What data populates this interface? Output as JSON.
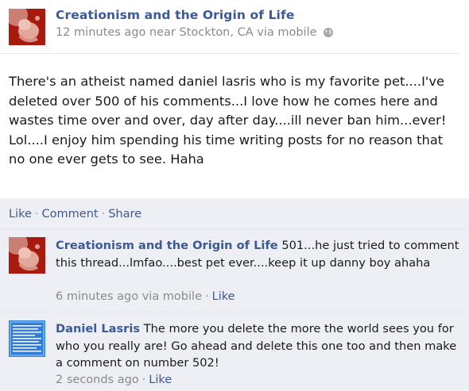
{
  "post": {
    "page_name": "Creationism and the Origin of Life",
    "meta": "12 minutes ago near Stockton, CA via mobile",
    "body": "There's an atheist named daniel lasris who is my favorite pet....I've deleted over 500 of his comments...I love how he comes here and wastes time over and over, day after day....ill never ban him...ever! Lol....I enjoy him spending his time writing posts for no reason that no one ever gets to see. Haha"
  },
  "actions": {
    "like": "Like",
    "comment": "Comment",
    "share": "Share",
    "separator": "·"
  },
  "comments": [
    {
      "author": "Creationism and the Origin of Life",
      "text": "501...he just tried to comment this thread...lmfao....best pet ever....keep it up danny boy ahaha",
      "time": "6 minutes ago via mobile",
      "like": "Like"
    },
    {
      "author": "Daniel Lasris",
      "text": "The more you delete the more the world sees you for who you really are! Go ahead and delete this one too and then make a comment on number 502!",
      "time": "2 seconds ago",
      "like": "Like"
    }
  ],
  "colors": {
    "link": "#3b5998",
    "meta": "#8a8a8a",
    "feedback_bg": "#edeff4"
  },
  "icons": {
    "privacy": "globe-icon"
  }
}
